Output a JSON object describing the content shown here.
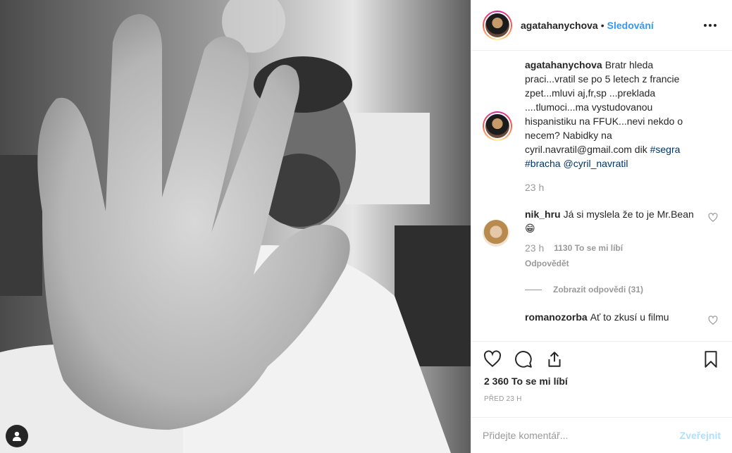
{
  "post": {
    "author": "agatahanychova",
    "follow_label": "Sledování",
    "separator": "•"
  },
  "caption": {
    "username": "agatahanychova",
    "text": "Bratr hleda praci...vratil se po 5 letech z francie zpet...mluvi aj,fr,sp ...preklada ....tlumoci...ma vystudovanou hispanistiku na FFUK...nevi nekdo o necem? Nabidky na cyril.navratil@gmail.com dik",
    "tags": [
      "#segra",
      "#bracha",
      "@cyril_navratil"
    ],
    "age": "23 h"
  },
  "comments": [
    {
      "username": "nik_hru",
      "text": "Já si myslela že to je Mr.Bean 😁",
      "age": "23 h",
      "likes": "1130 To se mi líbí",
      "reply_label": "Odpovědět",
      "view_replies": "Zobrazit odpovědi (31)"
    },
    {
      "username": "romanozorba",
      "text": "Ať to zkusí u filmu"
    }
  ],
  "actions": {
    "icons": [
      "heart-icon",
      "comment-icon",
      "share-icon",
      "bookmark-icon"
    ]
  },
  "likes": {
    "count": "2 360",
    "label": "To se mi líbí"
  },
  "timestamp": "PŘED 23 H",
  "composer": {
    "placeholder": "Přidejte komentář...",
    "post_label": "Zveřejnit"
  },
  "colors": {
    "accent": "#3897f0",
    "tag": "#003569",
    "muted": "#999999",
    "post_disabled": "#b2dffc"
  }
}
